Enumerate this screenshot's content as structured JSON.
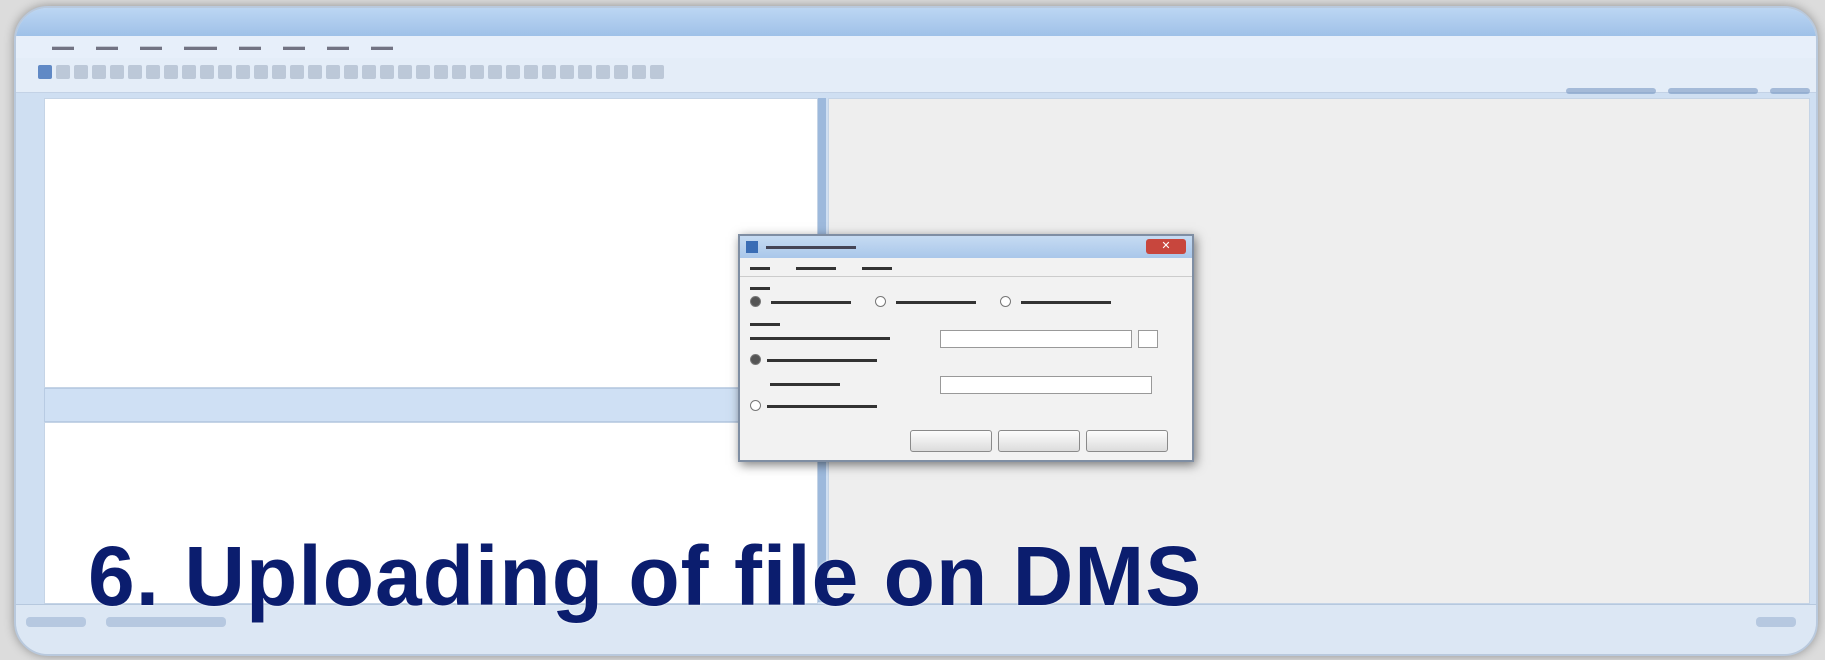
{
  "headline": "6. Uploading of file on DMS"
}
